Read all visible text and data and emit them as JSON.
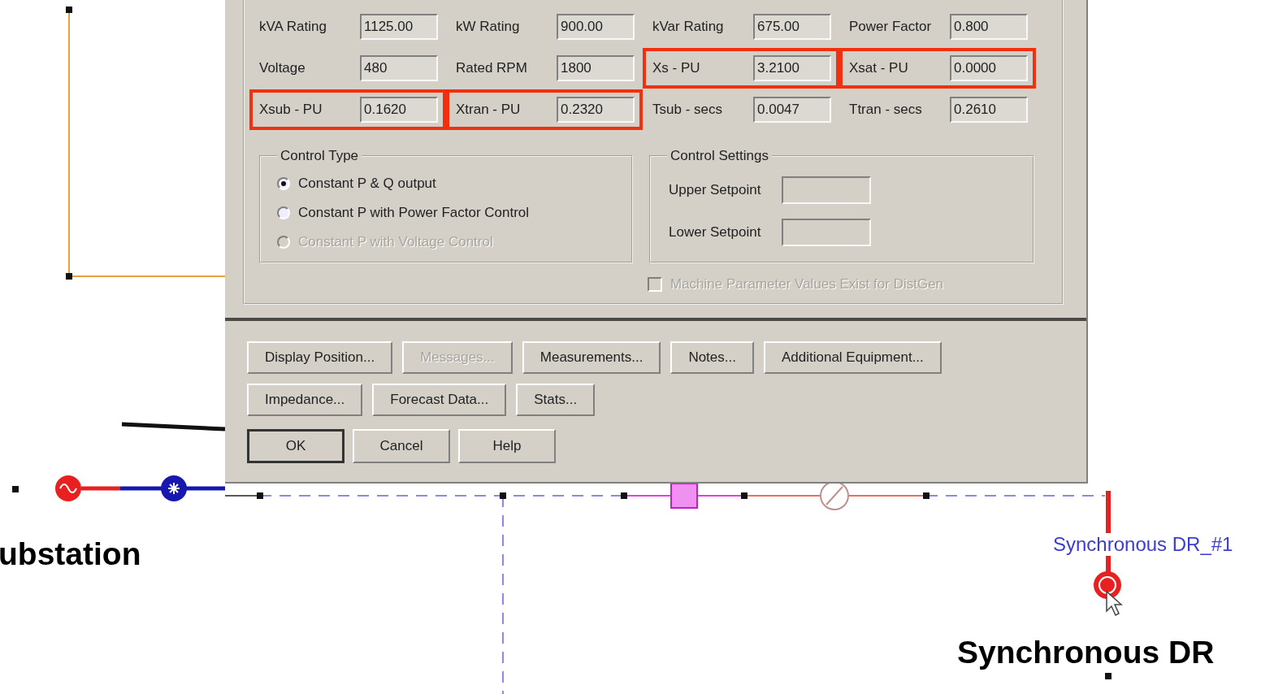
{
  "parameters": {
    "fields": [
      {
        "label": "kVA Rating",
        "value": "1125.00",
        "highlighted": false
      },
      {
        "label": "kW Rating",
        "value": "900.00",
        "highlighted": false
      },
      {
        "label": "kVar Rating",
        "value": "675.00",
        "highlighted": false
      },
      {
        "label": "Power Factor",
        "value": "0.800",
        "highlighted": false
      },
      {
        "label": "Voltage",
        "value": "480",
        "highlighted": false
      },
      {
        "label": "Rated RPM",
        "value": "1800",
        "highlighted": false
      },
      {
        "label": "Xs - PU",
        "value": "3.2100",
        "highlighted": true
      },
      {
        "label": "Xsat - PU",
        "value": "0.0000",
        "highlighted": true
      },
      {
        "label": "Xsub - PU",
        "value": "0.1620",
        "highlighted": true
      },
      {
        "label": "Xtran - PU",
        "value": "0.2320",
        "highlighted": true
      },
      {
        "label": "Tsub - secs",
        "value": "0.0047",
        "highlighted": false
      },
      {
        "label": "Ttran - secs",
        "value": "0.2610",
        "highlighted": false
      }
    ]
  },
  "control_type": {
    "title": "Control Type",
    "options": [
      {
        "label": "Constant P & Q  output",
        "selected": true,
        "disabled": false
      },
      {
        "label": "Constant P with Power Factor Control",
        "selected": false,
        "disabled": false
      },
      {
        "label": "Constant P with Voltage Control",
        "selected": false,
        "disabled": true
      }
    ]
  },
  "control_settings": {
    "title": "Control Settings",
    "fields": [
      {
        "label": "Upper Setpoint"
      },
      {
        "label": "Lower Setpoint"
      }
    ]
  },
  "machine_checkbox": {
    "label": "Machine Parameter Values Exist for DistGen",
    "checked": false,
    "disabled": true
  },
  "button_rows": [
    [
      {
        "label": "Display Position...",
        "disabled": false
      },
      {
        "label": "Messages...",
        "disabled": true
      },
      {
        "label": "Measurements...",
        "disabled": false
      },
      {
        "label": "Notes...",
        "disabled": false
      },
      {
        "label": "Additional Equipment...",
        "disabled": false
      }
    ],
    [
      {
        "label": "Impedance...",
        "disabled": false
      },
      {
        "label": "Forecast Data...",
        "disabled": false
      },
      {
        "label": "Stats...",
        "disabled": false
      }
    ]
  ],
  "dialog_buttons": [
    {
      "label": "OK",
      "default": true
    },
    {
      "label": "Cancel",
      "default": false
    },
    {
      "label": "Help",
      "default": false
    }
  ],
  "diagram": {
    "substation_label": "ubstation",
    "node_label": "Synchronous DR_#1",
    "callout_label": "Synchronous DR"
  }
}
